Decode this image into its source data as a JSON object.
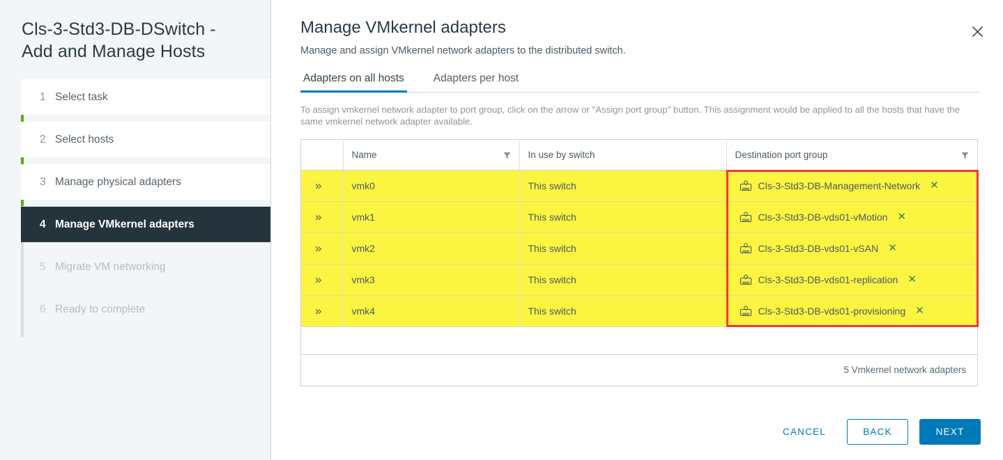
{
  "sidebar": {
    "title": "Cls-3-Std3-DB-DSwitch - Add and Manage Hosts",
    "steps": [
      {
        "num": "1",
        "label": "Select task",
        "state": "completed"
      },
      {
        "num": "2",
        "label": "Select hosts",
        "state": "completed"
      },
      {
        "num": "3",
        "label": "Manage physical adapters",
        "state": "completed"
      },
      {
        "num": "4",
        "label": "Manage VMkernel adapters",
        "state": "active"
      },
      {
        "num": "5",
        "label": "Migrate VM networking",
        "state": "disabled"
      },
      {
        "num": "6",
        "label": "Ready to complete",
        "state": "disabled"
      }
    ]
  },
  "main": {
    "title": "Manage VMkernel adapters",
    "subtitle": "Manage and assign VMkernel network adapters to the distributed switch.",
    "close_icon": "close-icon",
    "tabs": [
      {
        "label": "Adapters on all hosts",
        "active": true
      },
      {
        "label": "Adapters per host",
        "active": false
      }
    ],
    "hint": "To assign vmkernel network adapter to port group, click on the arrow or \"Assign port group\" button. This assignment would be applied to all the hosts that have the same vmkernel network adapter available.",
    "table": {
      "columns": [
        "",
        "Name",
        "In use by switch",
        "Destination port group"
      ],
      "rows": [
        {
          "expand": "»",
          "name": "vmk0",
          "in_use": "This switch",
          "dest": "Cls-3-Std3-DB-Management-Network",
          "remove": "✕"
        },
        {
          "expand": "»",
          "name": "vmk1",
          "in_use": "This switch",
          "dest": "Cls-3-Std3-DB-vds01-vMotion",
          "remove": "✕"
        },
        {
          "expand": "»",
          "name": "vmk2",
          "in_use": "This switch",
          "dest": "Cls-3-Std3-DB-vds01-vSAN",
          "remove": "✕"
        },
        {
          "expand": "»",
          "name": "vmk3",
          "in_use": "This switch",
          "dest": "Cls-3-Std3-DB-vds01-replication",
          "remove": "✕"
        },
        {
          "expand": "»",
          "name": "vmk4",
          "in_use": "This switch",
          "dest": "Cls-3-Std3-DB-vds01-provisioning",
          "remove": "✕"
        }
      ],
      "footer_count": "5 Vmkernel network adapters"
    },
    "buttons": {
      "cancel": "CANCEL",
      "back": "BACK",
      "next": "NEXT"
    }
  },
  "colors": {
    "accent_blue": "#0079b8",
    "progress_green": "#60a917",
    "active_step_bg": "#25333d",
    "row_highlight_yellow": "#fbf440",
    "annotation_red": "#f2383a",
    "remove_icon_green": "#2d8659"
  }
}
